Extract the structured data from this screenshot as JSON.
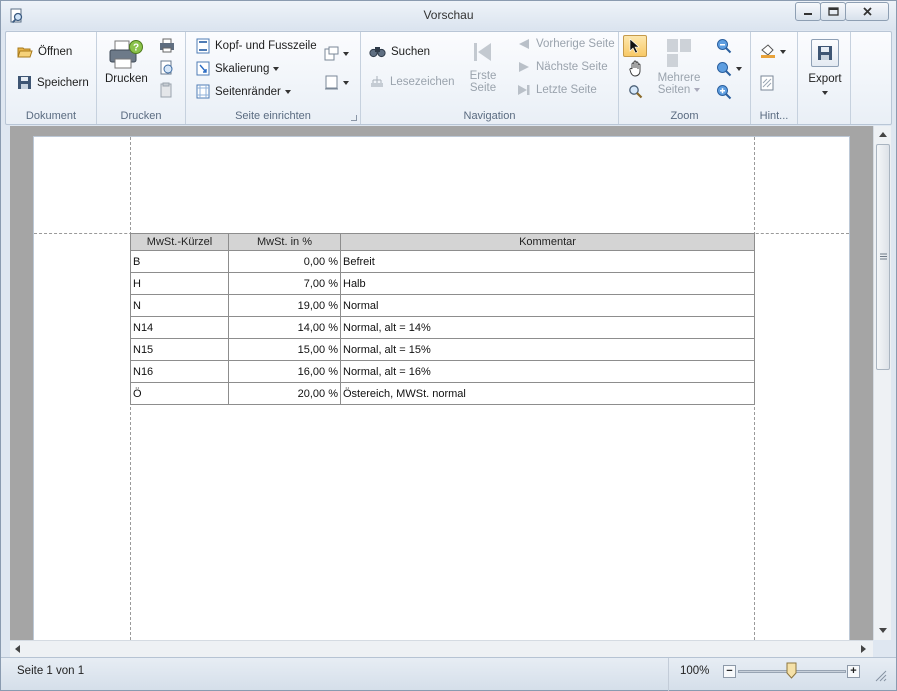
{
  "window": {
    "title": "Vorschau"
  },
  "ribbon": {
    "dokument": {
      "label": "Dokument",
      "open": "Öffnen",
      "save": "Speichern"
    },
    "drucken": {
      "label": "Drucken",
      "print": "Drucken"
    },
    "seite": {
      "label": "Seite einrichten",
      "header_footer": "Kopf- und Fusszeile",
      "scaling": "Skalierung",
      "margins": "Seitenränder"
    },
    "navigation": {
      "label": "Navigation",
      "search": "Suchen",
      "bookmarks": "Lesezeichen",
      "first_line1": "Erste",
      "first_line2": "Seite",
      "prev": "Vorherige Seite",
      "next": "Nächste Seite",
      "last": "Letzte Seite"
    },
    "zoom": {
      "label": "Zoom",
      "multi_line1": "Mehrere",
      "multi_line2": "Seiten"
    },
    "hint": {
      "label": "Hint..."
    },
    "export": {
      "label": "Export"
    }
  },
  "table": {
    "headers": [
      "MwSt.-Kürzel",
      "MwSt. in %",
      "Kommentar"
    ],
    "rows": [
      [
        "B",
        "0,00 %",
        "Befreit"
      ],
      [
        "H",
        "7,00 %",
        "Halb"
      ],
      [
        "N",
        "19,00 %",
        "Normal"
      ],
      [
        "N14",
        "14,00 %",
        "Normal, alt = 14%"
      ],
      [
        "N15",
        "15,00 %",
        "Normal, alt = 15%"
      ],
      [
        "N16",
        "16,00 %",
        "Normal, alt = 16%"
      ],
      [
        "Ö",
        "20,00 %",
        "Östereich, MWSt. normal"
      ]
    ]
  },
  "status": {
    "page": "Seite 1 von 1",
    "zoom": "100%",
    "zoom_minus": "−",
    "zoom_plus": "+",
    "zoom_level_percent": 50
  },
  "colors": {
    "accent": "#2b6cc4",
    "window_frame": "#dfe7f1"
  }
}
